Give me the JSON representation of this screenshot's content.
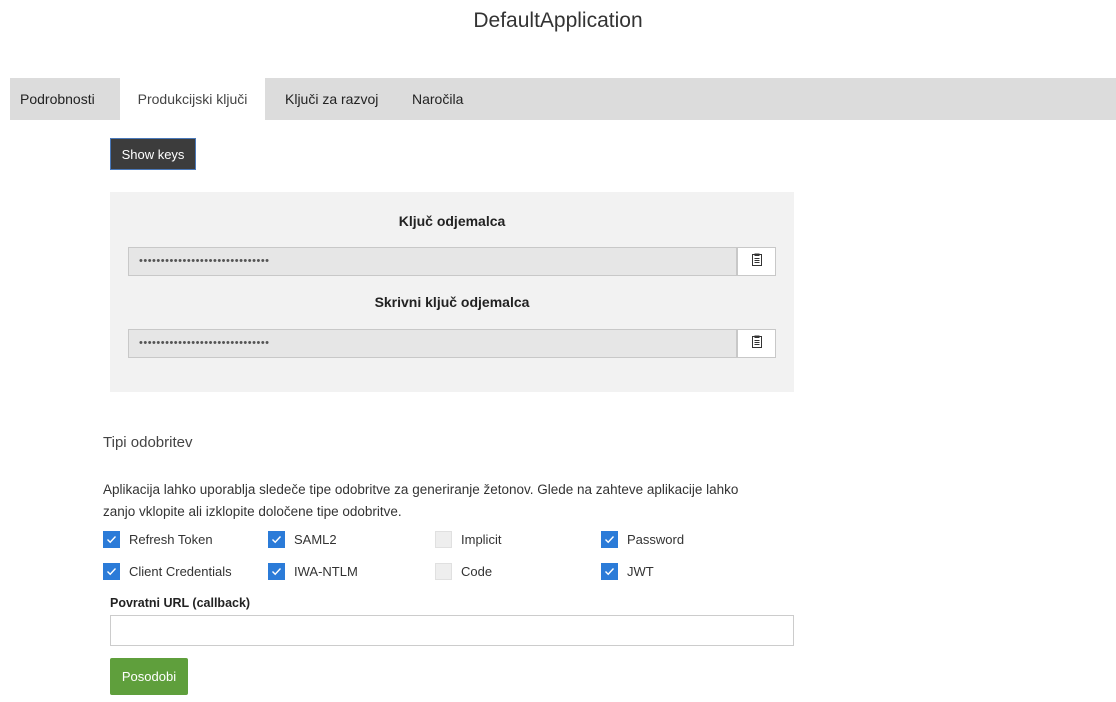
{
  "app": {
    "title": "DefaultApplication"
  },
  "tabs": [
    {
      "label": "Podrobnosti"
    },
    {
      "label": "Produkcijski ključi"
    },
    {
      "label": "Ključi za razvoj"
    },
    {
      "label": "Naročila"
    }
  ],
  "active_tab": "Produkcijski ključi",
  "keys": {
    "show_button": "Show keys",
    "consumer_key": {
      "label": "Ključ odjemalca",
      "value": "••••••••••••••••••••••••••••••"
    },
    "consumer_secret": {
      "label": "Skrivni ključ odjemalca",
      "value": "••••••••••••••••••••••••••••••"
    },
    "copy_icon": "clipboard-icon"
  },
  "grant_types": {
    "title": "Tipi odobritev",
    "description": "Aplikacija lahko uporablja sledeče tipe odobritve za generiranje žetonov. Glede na zahteve aplikacije lahko zanjo vklopite ali izklopite določene tipe odobritve.",
    "items": [
      {
        "label": "Refresh Token",
        "checked": true
      },
      {
        "label": "SAML2",
        "checked": true
      },
      {
        "label": "Implicit",
        "checked": false
      },
      {
        "label": "Password",
        "checked": true
      },
      {
        "label": "Client Credentials",
        "checked": true
      },
      {
        "label": "IWA-NTLM",
        "checked": true
      },
      {
        "label": "Code",
        "checked": false
      },
      {
        "label": "JWT",
        "checked": true
      }
    ]
  },
  "callback": {
    "label": "Povratni URL (callback)",
    "value": "",
    "placeholder": ""
  },
  "submit_button": "Posodobi",
  "colors": {
    "tabbar_bg": "#dcdcdc",
    "checkbox_checked": "#2b7bd8",
    "submit_bg": "#5f9f3c",
    "show_keys_bg": "#3c3c3c"
  }
}
